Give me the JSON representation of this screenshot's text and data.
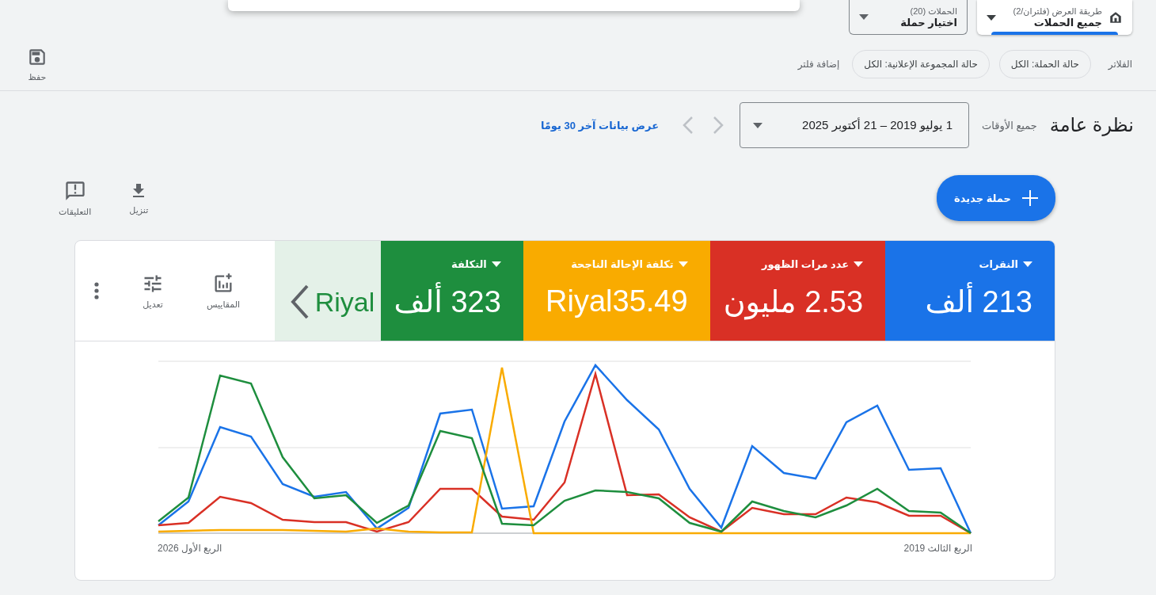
{
  "view_selector": {
    "label": "طريقة العرض (فلتران/2)",
    "value": "جميع الحملات"
  },
  "campaign_selector": {
    "label": "الحملات (20)",
    "value": "اختيار حملة"
  },
  "dropdown_panel": {
    "open": true
  },
  "filters": {
    "label": "الفلاتر",
    "chips": [
      "حالة الحملة: الكل",
      "حالة المجموعة الإعلانية: الكل"
    ],
    "add": "إضافة فلتر"
  },
  "save": {
    "label": "حفظ"
  },
  "overview": {
    "title": "نظرة عامة",
    "range_label": "جميع الأوقات",
    "range": "1 يوليو 2019 – 21 أكتوبر 2025",
    "next_disabled": true,
    "previous_disabled": true,
    "link": "عرض بيانات آخر 30 يومًا"
  },
  "new_campaign": {
    "label": "حملة جديدة"
  },
  "actions": [
    {
      "kind": "download",
      "label": "تنزيل"
    },
    {
      "kind": "feedback",
      "label": "التعليقات"
    }
  ],
  "metrics": [
    {
      "label": "النقرات",
      "value": "213 ألف",
      "color": "#1a73e8",
      "selected": true
    },
    {
      "label": "عدد مرات الظهور",
      "value": "2.53 مليون",
      "color": "#d93025",
      "selected": true
    },
    {
      "label": "تكلفة الإحالة الناجحة",
      "value": "Riyal35.49",
      "color": "#f9ab00",
      "selected": true
    },
    {
      "label": "التكلفة",
      "value": "323 ألف",
      "color": "#1e8e3e",
      "selected": true
    },
    {
      "value": "Riyal",
      "color": "#1e8e3e",
      "selected": false
    }
  ],
  "tools": [
    {
      "kind": "metrics",
      "label": "المقاييس"
    },
    {
      "kind": "adjust",
      "label": "تعديل"
    },
    {
      "kind": "more"
    }
  ],
  "chart": {
    "x_start": "الربع الثالث 2019",
    "x_end": "الربع الأول 2026"
  }
}
